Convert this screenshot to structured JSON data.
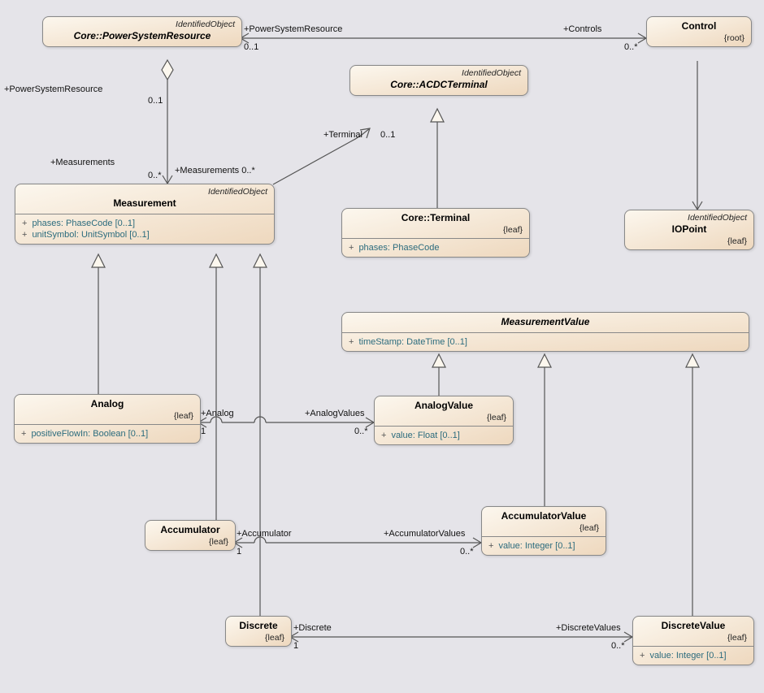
{
  "stereotypes": {
    "idobj": "IdentifiedObject"
  },
  "classes": {
    "psr": {
      "name": "Core::PowerSystemResource",
      "constraint": ""
    },
    "control": {
      "name": "Control",
      "constraint": "{root}"
    },
    "acdc": {
      "name": "Core::ACDCTerminal",
      "constraint": ""
    },
    "measurement": {
      "name": "Measurement",
      "constraint": "",
      "attrs": [
        "phases: PhaseCode [0..1]",
        "unitSymbol: UnitSymbol [0..1]"
      ]
    },
    "terminal": {
      "name": "Core::Terminal",
      "constraint": "{leaf}",
      "attrs": [
        "phases: PhaseCode"
      ]
    },
    "iopoint": {
      "name": "IOPoint",
      "constraint": "{leaf}"
    },
    "mvalue": {
      "name": "MeasurementValue",
      "constraint": "",
      "attrs": [
        "timeStamp: DateTime [0..1]"
      ]
    },
    "analog": {
      "name": "Analog",
      "constraint": "{leaf}",
      "attrs": [
        "positiveFlowIn: Boolean [0..1]"
      ]
    },
    "analogv": {
      "name": "AnalogValue",
      "constraint": "{leaf}",
      "attrs": [
        "value: Float [0..1]"
      ]
    },
    "accum": {
      "name": "Accumulator",
      "constraint": "{leaf}"
    },
    "accumv": {
      "name": "AccumulatorValue",
      "constraint": "{leaf}",
      "attrs": [
        "value: Integer [0..1]"
      ]
    },
    "discrete": {
      "name": "Discrete",
      "constraint": "{leaf}"
    },
    "discretev": {
      "name": "DiscreteValue",
      "constraint": "{leaf}",
      "attrs": [
        "value: Integer [0..1]"
      ]
    }
  },
  "labels": {
    "psr_end": "+PowerSystemResource",
    "psr_mult": "0..1",
    "controls_end": "+Controls",
    "controls_mult": "0..*",
    "measurements_end": "+Measurements",
    "measurements_mult": "0..*",
    "measurements2_end": "+Measurements 0..*",
    "terminal_end": "+Terminal",
    "terminal_mult": "0..1",
    "analog_end": "+Analog",
    "analog_mult": "1",
    "analogvalues_end": "+AnalogValues",
    "analogvalues_mult": "0..*",
    "accum_end": "+Accumulator",
    "accum_mult": "1",
    "accumvalues_end": "+AccumulatorValues",
    "accumvalues_mult": "0..*",
    "discrete_end": "+Discrete",
    "discrete_mult": "1",
    "discretevalues_end": "+DiscreteValues",
    "discretevalues_mult": "0..*"
  }
}
